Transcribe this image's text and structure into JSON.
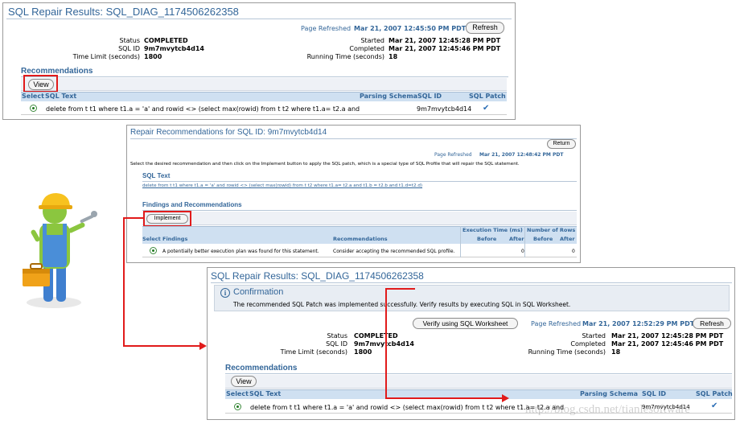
{
  "panel1": {
    "title": "SQL Repair Results: SQL_DIAG_1174506262358",
    "page_refreshed_label": "Page Refreshed",
    "page_refreshed_value": "Mar 21, 2007 12:45:50 PM PDT",
    "refresh_label": "Refresh",
    "status_label": "Status",
    "status_value": "COMPLETED",
    "sqlid_label": "SQL ID",
    "sqlid_value": "9m7mvytcb4d14",
    "timelimit_label": "Time Limit (seconds)",
    "timelimit_value": "1800",
    "started_label": "Started",
    "started_value": "Mar 21, 2007 12:45:28 PM PDT",
    "completed_label": "Completed",
    "completed_value": "Mar 21, 2007 12:45:46 PM PDT",
    "running_label": "Running Time (seconds)",
    "running_value": "18",
    "recommendations_heading": "Recommendations",
    "view_label": "View",
    "columns": {
      "select": "Select",
      "sql_text": "SQL Text",
      "parsing_schema": "Parsing Schema",
      "sql_id": "SQL ID",
      "sql_patch": "SQL Patch"
    },
    "row": {
      "sql_text": "delete from t t1 where t1.a = 'a' and rowid <> (select max(rowid) from t t2 where t1.a= t2.a and t1....",
      "sql_id": "9m7mvytcb4d14",
      "patch": "✔"
    }
  },
  "panel2": {
    "title": "Repair Recommendations for SQL ID: 9m7mvytcb4d14",
    "return_label": "Return",
    "page_refreshed_label": "Page Refreshed",
    "page_refreshed_value": "Mar 21, 2007 12:48:42 PM PDT",
    "instructions": "Select the desired recommendation and then click on the Implement button to apply the SQL patch, which is a special type of SQL Profile that will repair the SQL statement.",
    "sql_text_heading": "SQL Text",
    "sql_text_link": "delete from t t1 where t1.a = 'a' and rowid <> (select max(rowid) from t t2 where t1.a= t2.a and t1.b = t2.b and t1.d=t2.d)",
    "findings_heading": "Findings and Recommendations",
    "implement_label": "Implement",
    "columns": {
      "exec_time": "Execution Time (ms)",
      "num_rows": "Number of Rows",
      "select": "Select",
      "findings": "Findings",
      "recommendations": "Recommendations",
      "before": "Before",
      "after": "After"
    },
    "row": {
      "finding": "A potentially better execution plan was found for this statement.",
      "recommendation": "Consider accepting the recommended SQL profile.",
      "exec_before": "",
      "exec_after": "0",
      "rows_before": "",
      "rows_after": "0"
    }
  },
  "panel3": {
    "title": "SQL Repair Results: SQL_DIAG_1174506262358",
    "confirmation_heading": "Confirmation",
    "confirmation_text": "The recommended SQL Patch was implemented successfully. Verify results by executing SQL in SQL Worksheet.",
    "verify_label": "Verify using SQL Worksheet",
    "page_refreshed_label": "Page Refreshed",
    "page_refreshed_value": "Mar 21, 2007 12:52:29 PM PDT",
    "refresh_label": "Refresh",
    "status_label": "Status",
    "status_value": "COMPLETED",
    "sqlid_label": "SQL ID",
    "sqlid_value": "9m7mvytcb4d14",
    "timelimit_label": "Time Limit (seconds)",
    "timelimit_value": "1800",
    "started_label": "Started",
    "started_value": "Mar 21, 2007 12:45:28 PM PDT",
    "completed_label": "Completed",
    "completed_value": "Mar 21, 2007 12:45:46 PM PDT",
    "running_label": "Running Time (seconds)",
    "running_value": "18",
    "recommendations_heading": "Recommendations",
    "view_label": "View",
    "columns": {
      "select": "Select",
      "sql_text": "SQL Text",
      "parsing_schema": "Parsing Schema",
      "sql_id": "SQL ID",
      "sql_patch": "SQL Patch"
    },
    "row": {
      "sql_text": "delete from t t1 where t1.a = 'a' and rowid <> (select max(rowid) from t t2 where t1.a= t2.a and t1....",
      "sql_id": "9m7mvytcb4d14",
      "patch": "✔"
    }
  },
  "watermark": "http://blog.csdn.net/tianlesoftware",
  "colors": {
    "accent": "#336699",
    "header_bg": "#cfe0f1",
    "highlight": "#e11b1b"
  }
}
